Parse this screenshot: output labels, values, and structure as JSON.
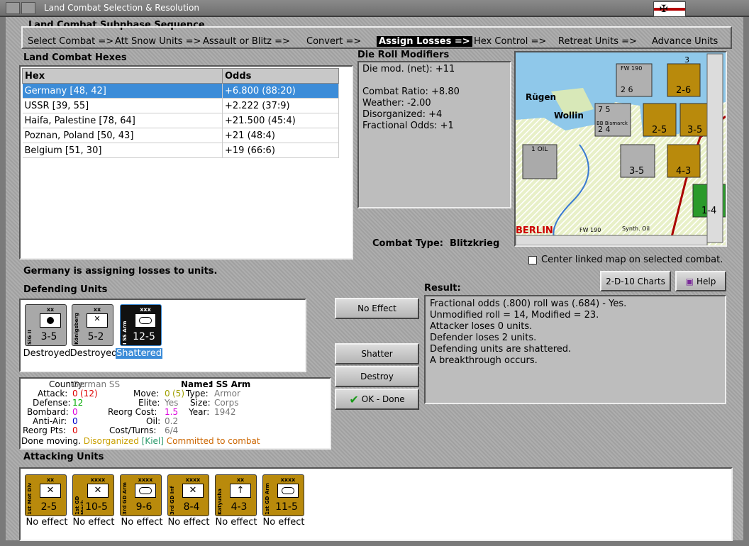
{
  "window": {
    "title": "Land Combat Selection & Resolution"
  },
  "subphase": {
    "title": "Land Combat Subphase Sequence",
    "steps": [
      "Select Combat =>",
      "Att Snow Units =>",
      "Assault or Blitz =>",
      "Convert =>",
      "Assign Losses =>",
      "Hex Control =>",
      "Retreat Units =>",
      "Advance Units"
    ],
    "active_index": 4
  },
  "hexes": {
    "title": "Land Combat Hexes",
    "col_hex": "Hex",
    "col_odds": "Odds",
    "rows": [
      {
        "hex": "Germany [48, 42]",
        "odds": "+6.800 (88:20)"
      },
      {
        "hex": "USSR [39, 55]",
        "odds": "+2.222 (37:9)"
      },
      {
        "hex": "Haifa, Palestine [78, 64]",
        "odds": "+21.500 (45:4)"
      },
      {
        "hex": "Poznan, Poland [50, 43]",
        "odds": "+21 (48:4)"
      },
      {
        "hex": "Belgium [51, 30]",
        "odds": "+19 (66:6)"
      }
    ]
  },
  "die": {
    "title": "Die Roll Modifiers",
    "lines": [
      "Die mod. (net): +11",
      "",
      "Combat Ratio: +8.80",
      "Weather: -2.00",
      "Disorganized: +4",
      "Fractional Odds: +1"
    ]
  },
  "combat_type": {
    "label": "Combat Type:",
    "value": "Blitzkrieg"
  },
  "center_map": {
    "label": "Center linked map on selected combat.",
    "checked": false
  },
  "status": "Germany is assigning losses to units.",
  "buttons": {
    "charts": "2-D-10 Charts",
    "help": "Help",
    "no_effect": "No Effect",
    "shatter": "Shatter",
    "destroy": "Destroy",
    "ok": "OK - Done"
  },
  "defending": {
    "title": "Defending Units",
    "units": [
      {
        "side": "SiG II",
        "size": "xx",
        "str": "3-5",
        "status": "Destroyed",
        "color": "grey"
      },
      {
        "side": "Königsberg",
        "size": "xx",
        "str": "5-2",
        "status": "Destroyed",
        "color": "grey"
      },
      {
        "side": "I SS Arm",
        "size": "xxx",
        "str": "12-5",
        "status": "Shattered",
        "color": "black"
      }
    ]
  },
  "info": {
    "country_l": "Country:",
    "country": "German SS",
    "name_l": "Name:",
    "name": "I SS Arm",
    "attack_l": "Attack:",
    "attack": "0",
    "attack2": "(12)",
    "move_l": "Move:",
    "move": "0",
    "move2": "(5)",
    "type_l": "Type:",
    "type": "Armor",
    "defense_l": "Defense:",
    "defense": "12",
    "elite_l": "Elite:",
    "elite": "Yes",
    "size_l": "Size:",
    "size": "Corps",
    "bombard_l": "Bombard:",
    "bombard": "0",
    "reorg_l": "Reorg Cost:",
    "reorg": "1.5",
    "year_l": "Year:",
    "year": "1942",
    "aa_l": "Anti-Air:",
    "aa": "0",
    "oil_l": "Oil:",
    "oil": "0.2",
    "rpts_l": "Reorg Pts:",
    "rpts": "0",
    "ct_l": "Cost/Turns:",
    "ct": "6/4",
    "foot1": "Done moving.",
    "foot2": "Disorganized",
    "foot3": "[Kiel]",
    "foot4": "Committed to combat"
  },
  "result": {
    "title": "Result:",
    "lines": [
      "Fractional odds (.800) roll was (.684)  - Yes.",
      "Unmodified roll = 14, Modified = 23.",
      "Attacker loses 0 units.",
      "Defender loses 2 units.",
      "Defending units are shattered.",
      "A breakthrough occurs."
    ]
  },
  "attacking": {
    "title": "Attacking Units",
    "units": [
      {
        "side": "1st Mot Div",
        "size": "xx",
        "str": "2-5",
        "status": "No effect"
      },
      {
        "side": "1st GD Mech",
        "size": "xxxx",
        "str": "10-5",
        "status": "No effect"
      },
      {
        "side": "3rd GD Arm",
        "size": "xxxx",
        "str": "9-6",
        "status": "No effect"
      },
      {
        "side": "3rd GD Inf",
        "size": "xxxx",
        "str": "8-4",
        "status": "No effect"
      },
      {
        "side": "Katyusha",
        "size": "xx",
        "str": "4-3",
        "status": "No effect"
      },
      {
        "side": "1st GD Arm",
        "size": "xxxx",
        "str": "11-5",
        "status": "No effect"
      }
    ]
  },
  "map": {
    "labels": {
      "rugen": "Rügen",
      "wollin": "Wollin",
      "berlin": "BERLIN",
      "oil": "1 OIL",
      "bismarck": "BB Bismarck",
      "synth": "Synth. Oil",
      "fw": "FW 190",
      "fw2": "FW 190"
    },
    "counters": [
      "2-6",
      "2-5",
      "3-5",
      "3-5",
      "4-3",
      "1-4",
      "2 6",
      "2 4",
      "7 5",
      "3"
    ]
  }
}
